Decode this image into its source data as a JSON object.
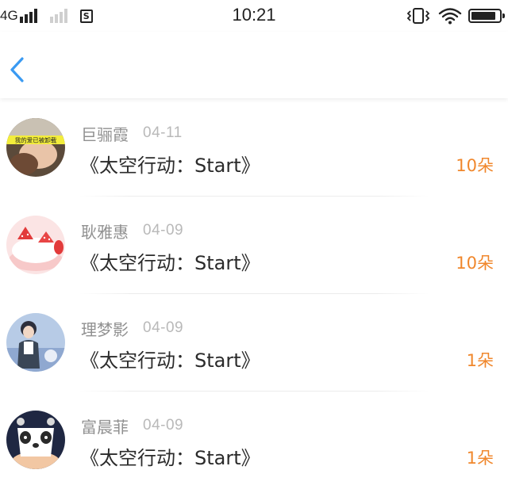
{
  "status_bar": {
    "network": "4G",
    "time": "10:21",
    "sim_glyph": "S",
    "battery_level": 0.88,
    "icons": [
      "signal-bars-icon",
      "signal-bars-secondary-icon",
      "sim-card-icon",
      "vibrate-icon",
      "wifi-icon",
      "battery-icon"
    ]
  },
  "navbar": {
    "back_icon": "chevron-left-icon",
    "accent_color": "#3a9af2"
  },
  "colors": {
    "amount": "#f0872c",
    "name": "#909090",
    "date": "#b9b9b9",
    "title": "#2b2b2b"
  },
  "gifts": [
    {
      "name": "巨骊霞",
      "date": "04-11",
      "title": "《太空行动：Start》",
      "amount": "10朵",
      "avatar_banner": "我的爱已被卸载"
    },
    {
      "name": "耿雅惠",
      "date": "04-09",
      "title": "《太空行动：Start》",
      "amount": "10朵"
    },
    {
      "name": "理梦影",
      "date": "04-09",
      "title": "《太空行动：Start》",
      "amount": "1朵"
    },
    {
      "name": "富晨菲",
      "date": "04-09",
      "title": "《太空行动：Start》",
      "amount": "1朵"
    }
  ]
}
